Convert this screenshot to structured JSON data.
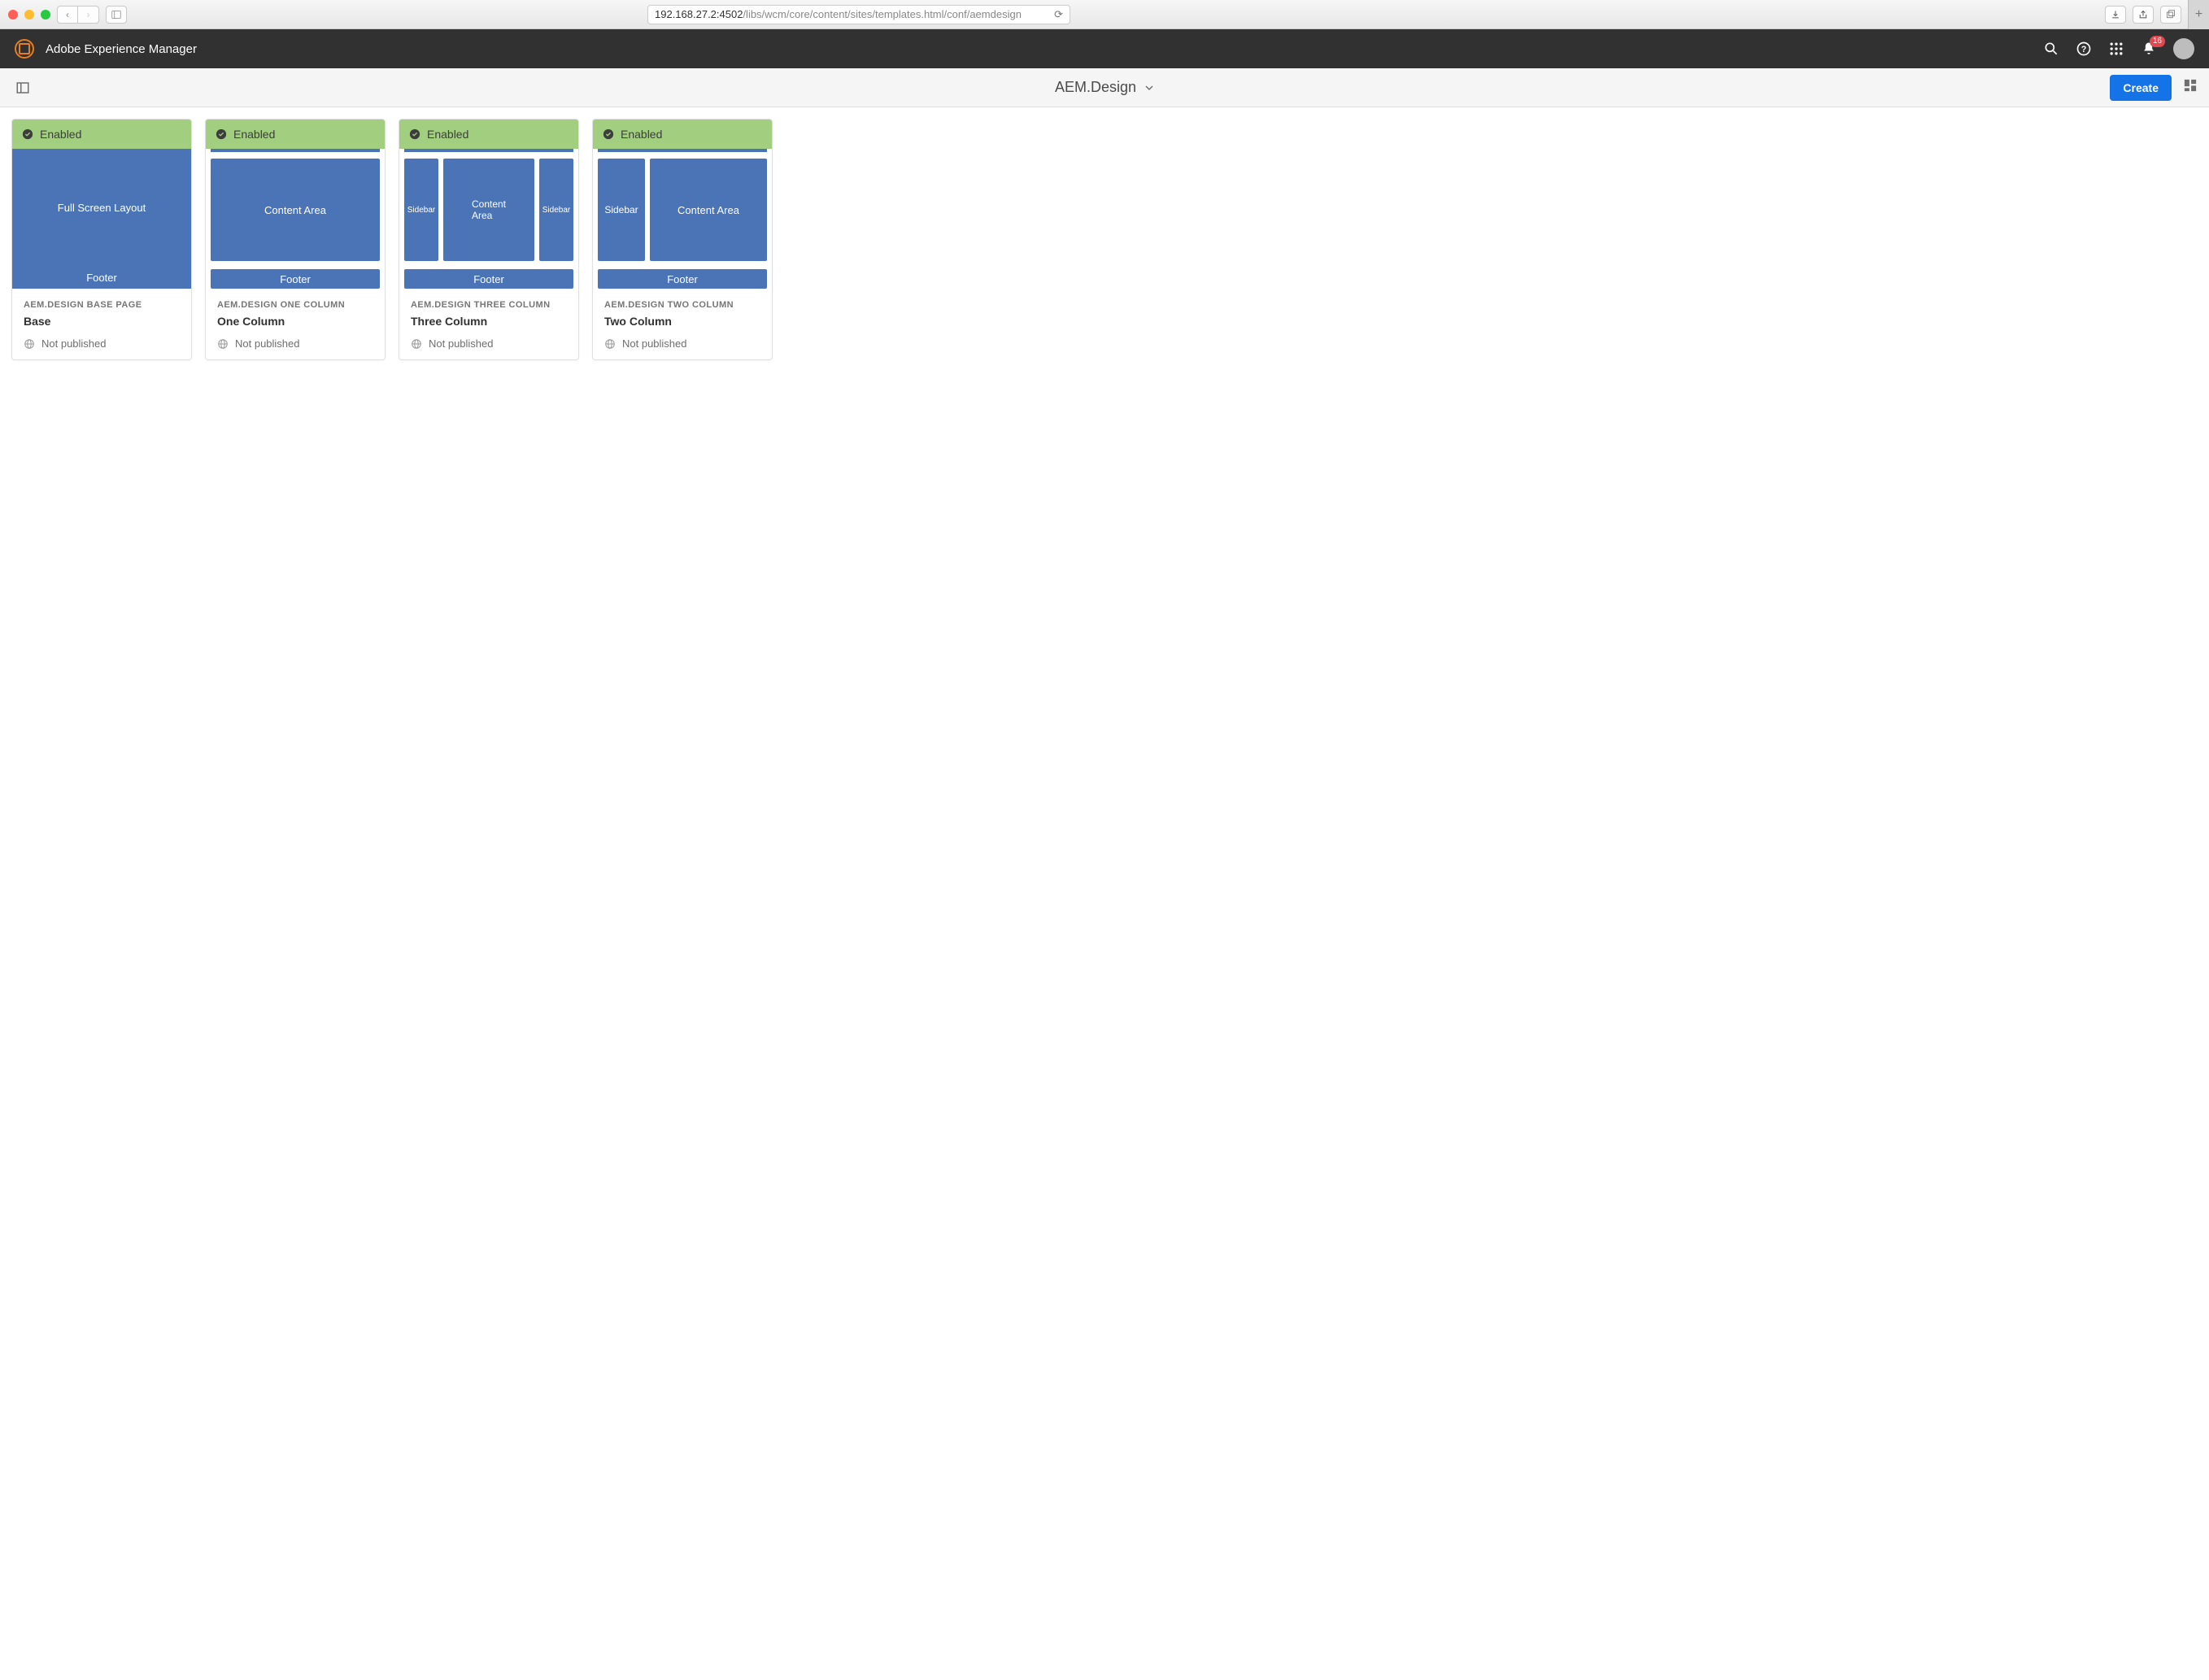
{
  "browser": {
    "url_host": "192.168.27.2:4502",
    "url_path": "/libs/wcm/core/content/sites/templates.html/conf/aemdesign"
  },
  "header": {
    "product_name": "Adobe Experience Manager",
    "notification_count": "16"
  },
  "actionbar": {
    "breadcrumb": "AEM.Design",
    "create_label": "Create"
  },
  "status_label": "Enabled",
  "publish_status": "Not published",
  "thumb_labels": {
    "full_screen": "Full Screen Layout",
    "footer": "Footer",
    "content_area": "Content Area",
    "content": "Content",
    "area": "Area",
    "sidebar": "Sidebar"
  },
  "cards": [
    {
      "type": "AEM.DESIGN BASE PAGE",
      "name": "Base",
      "layout": "base"
    },
    {
      "type": "AEM.DESIGN ONE COLUMN",
      "name": "One Column",
      "layout": "one"
    },
    {
      "type": "AEM.DESIGN THREE COLUMN",
      "name": "Three Column",
      "layout": "three"
    },
    {
      "type": "AEM.DESIGN TWO COLUMN",
      "name": "Two Column",
      "layout": "two"
    }
  ]
}
